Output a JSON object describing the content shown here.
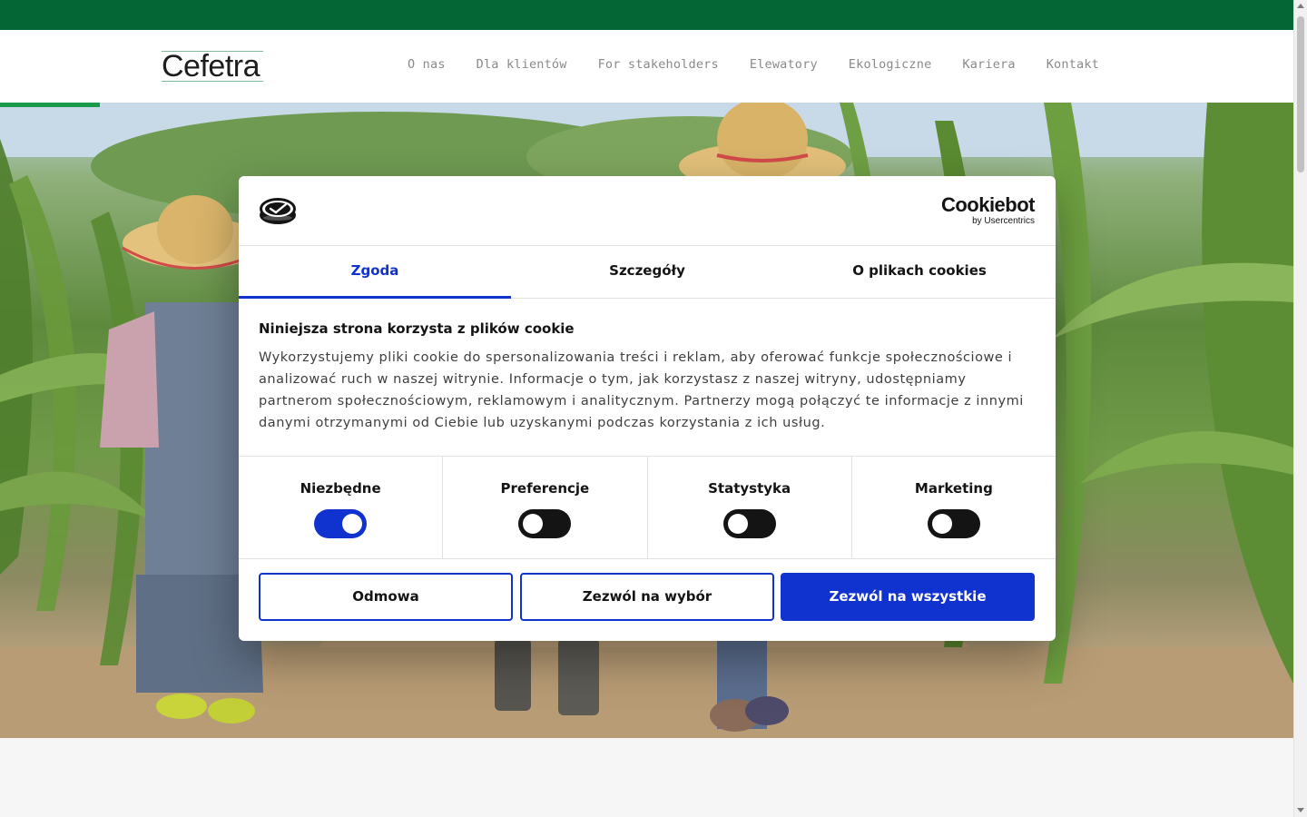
{
  "site": {
    "logo_text": "Cefetra",
    "nav": [
      "O nas",
      "Dla klientów",
      "For stakeholders",
      "Elewatory",
      "Ekologiczne",
      "Kariera",
      "Kontakt"
    ]
  },
  "cookie_dialog": {
    "brand": {
      "name": "Cookiebot",
      "sub": "by Usercentrics"
    },
    "tabs": [
      "Zgoda",
      "Szczegóły",
      "O plikach cookies"
    ],
    "active_tab": "Zgoda",
    "title": "Niniejsza strona korzysta z plików cookie",
    "text": "Wykorzystujemy pliki cookie do spersonalizowania treści i reklam, aby oferować funkcje społecznościowe i analizować ruch w naszej witrynie. Informacje o tym, jak korzystasz z naszej witryny, udostępniamy partnerom społecznościowym, reklamowym i analitycznym. Partnerzy mogą połączyć te informacje z innymi danymi otrzymanymi od Ciebie lub uzyskanymi podczas korzystania z ich usług.",
    "toggles": [
      {
        "label": "Niezbędne",
        "on": true
      },
      {
        "label": "Preferencje",
        "on": false
      },
      {
        "label": "Statystyka",
        "on": false
      },
      {
        "label": "Marketing",
        "on": false
      }
    ],
    "buttons": {
      "deny": "Odmowa",
      "allow_selection": "Zezwól na wybór",
      "allow_all": "Zezwól na wszystkie"
    }
  },
  "colors": {
    "topbar": "#046535",
    "accent_green": "#1a9a4b",
    "cookie_blue": "#1032cf"
  }
}
